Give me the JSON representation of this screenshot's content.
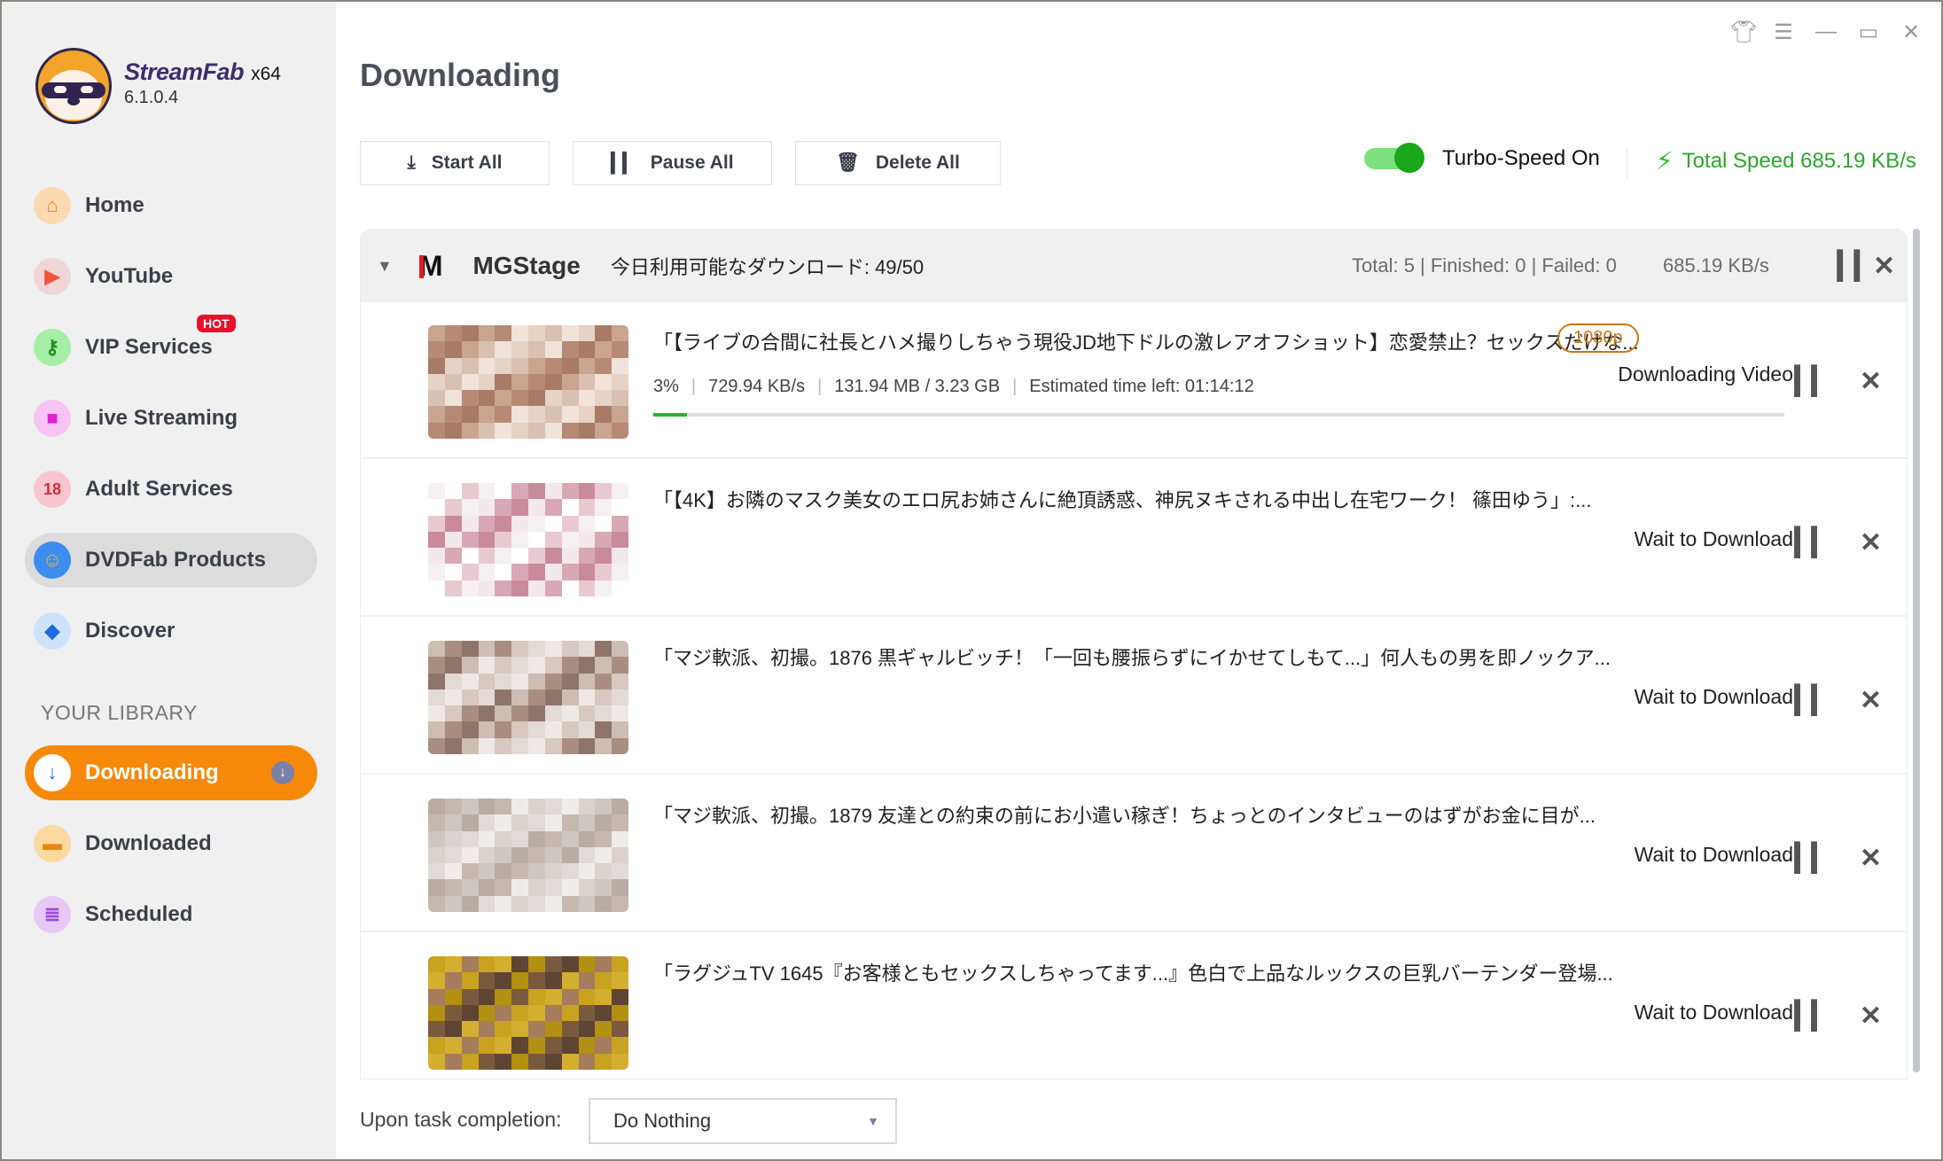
{
  "app": {
    "name": "StreamFab",
    "arch": "x64",
    "version": "6.1.0.4"
  },
  "window_controls": [
    "skin-icon",
    "menu-icon",
    "minimize-icon",
    "maximize-icon",
    "close-icon"
  ],
  "sidebar": {
    "items": [
      {
        "label": "Home",
        "icon": "home-icon",
        "color": "#e8860f",
        "bg": "#fcd9b0"
      },
      {
        "label": "YouTube",
        "icon": "youtube-icon",
        "color": "#f0523c",
        "bg": "#f2d6d6"
      },
      {
        "label": "VIP Services",
        "icon": "key-icon",
        "color": "#1f8f1f",
        "bg": "#a5eea5",
        "badge": "HOT"
      },
      {
        "label": "Live Streaming",
        "icon": "camera-icon",
        "color": "#e21fd7",
        "bg": "#f8c4f6"
      },
      {
        "label": "Adult Services",
        "icon": "adult-18-icon",
        "color": "#d92a38",
        "bg": "#f9c5cf"
      },
      {
        "label": "DVDFab Products",
        "icon": "dvdfab-icon",
        "color": "#2b6fd6",
        "bg": "#3d8cf0"
      },
      {
        "label": "Discover",
        "icon": "compass-icon",
        "color": "#1e6ae0",
        "bg": "#cfe2fb"
      }
    ],
    "library_heading": "YOUR LIBRARY",
    "library_items": [
      {
        "label": "Downloading",
        "icon": "download-icon",
        "active": true
      },
      {
        "label": "Downloaded",
        "icon": "folder-icon",
        "color": "#e8860f",
        "bg": "#fcd9a0"
      },
      {
        "label": "Scheduled",
        "icon": "clipboard-icon",
        "color": "#9a4fd4",
        "bg": "#e8c8f6"
      }
    ]
  },
  "main": {
    "title": "Downloading",
    "toolbar": {
      "start_all": "Start All",
      "pause_all": "Pause All",
      "delete_all": "Delete All"
    },
    "turbo": {
      "label": "Turbo-Speed On",
      "enabled": true
    },
    "total_speed": "Total Speed 685.19 KB/s",
    "group": {
      "name": "MGStage",
      "quota": "今日利用可能なダウンロード: 49/50",
      "stats": "Total: 5 | Finished: 0 | Failed: 0",
      "speed": "685.19 KB/s",
      "items": [
        {
          "title": "「【ライブの合間に社長とハメ撮りしちゃう現役JD地下ドルの激レアオフショット】恋愛禁止？セックスだけな...",
          "quality": "1080p",
          "progress_pct": 3,
          "progress_label": "3%",
          "speed": "729.94 KB/s",
          "size": "131.94 MB / 3.23 GB",
          "eta": "Estimated time left: 01:14:12",
          "status": "Downloading Video"
        },
        {
          "title": "「【4K】お隣のマスク美女のエロ尻お姉さんに絶頂誘惑、神尻ヌキされる中出し在宅ワーク！ 篠田ゆう」:...",
          "status": "Wait to Download"
        },
        {
          "title": "「マジ軟派、初撮。1876 黒ギャルビッチ！「一回も腰振らずにイかせてしもて...」何人もの男を即ノックア...",
          "status": "Wait to Download"
        },
        {
          "title": "「マジ軟派、初撮。1879 友達との約束の前にお小遣い稼ぎ！ちょっとのインタビューのはずがお金に目が...",
          "status": "Wait to Download"
        },
        {
          "title": "「ラグジュTV 1645『お客様ともセックスしちゃってます...』色白で上品なルックスの巨乳バーテンダー登場...",
          "status": "Wait to Download"
        }
      ]
    },
    "footer": {
      "label": "Upon task completion:",
      "selected": "Do Nothing"
    }
  },
  "colors": {
    "accent": "#f7890a",
    "turbo_green": "#1aa81a",
    "speed_green": "#2fa52f",
    "quality_badge": "#c57a1c",
    "hot_badge": "#e8112b"
  }
}
